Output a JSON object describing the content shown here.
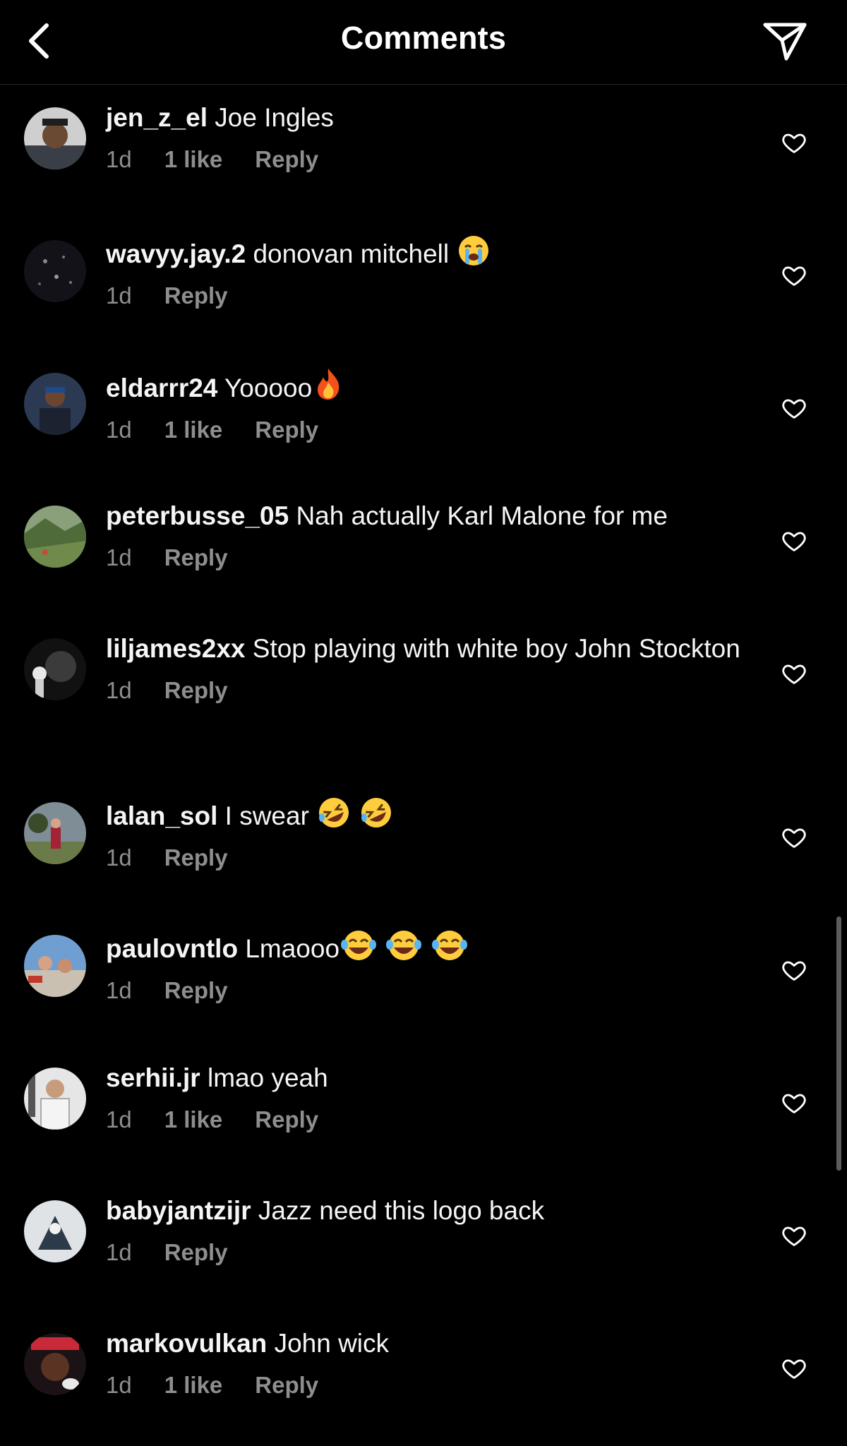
{
  "header": {
    "title": "Comments",
    "back_icon": "chevron-left-icon",
    "share_icon": "paper-plane-icon"
  },
  "comments": [
    {
      "username": "jen_z_el",
      "text": "Joe Ingles",
      "emojis": [],
      "time": "1d",
      "likes": "1 like",
      "reply": "Reply"
    },
    {
      "username": "wavyy.jay.2",
      "text": "donovan mitchell",
      "emojis": [
        "loudly-crying-face"
      ],
      "time": "1d",
      "likes": "",
      "reply": "Reply"
    },
    {
      "username": "eldarrr24",
      "text": "Yooooo",
      "emojis": [
        "fire"
      ],
      "time": "1d",
      "likes": "1 like",
      "reply": "Reply"
    },
    {
      "username": "peterbusse_05",
      "text": "Nah actually Karl Malone for me",
      "emojis": [],
      "time": "1d",
      "likes": "",
      "reply": "Reply"
    },
    {
      "username": "liljames2xx",
      "text": "Stop playing with white boy John Stockton",
      "emojis": [],
      "time": "1d",
      "likes": "",
      "reply": "Reply"
    },
    {
      "username": "lalan_sol",
      "text": "I swear",
      "emojis": [
        "rolling-on-floor-laughing",
        "rolling-on-floor-laughing"
      ],
      "time": "1d",
      "likes": "",
      "reply": "Reply"
    },
    {
      "username": "paulovntlo",
      "text": "Lmaooo",
      "emojis": [
        "face-with-tears-of-joy",
        "face-with-tears-of-joy",
        "face-with-tears-of-joy"
      ],
      "time": "1d",
      "likes": "",
      "reply": "Reply"
    },
    {
      "username": "serhii.jr",
      "text": "lmao yeah",
      "emojis": [],
      "time": "1d",
      "likes": "1 like",
      "reply": "Reply"
    },
    {
      "username": "babyjantzijr",
      "text": "Jazz need this logo back",
      "emojis": [],
      "time": "1d",
      "likes": "",
      "reply": "Reply"
    },
    {
      "username": "markovulkan",
      "text": "John wick",
      "emojis": [],
      "time": "1d",
      "likes": "1 like",
      "reply": "Reply"
    }
  ],
  "colors": {
    "background": "#000000",
    "text": "#f5f5f5",
    "secondary": "#8e8e8e",
    "divider": "#262626"
  }
}
